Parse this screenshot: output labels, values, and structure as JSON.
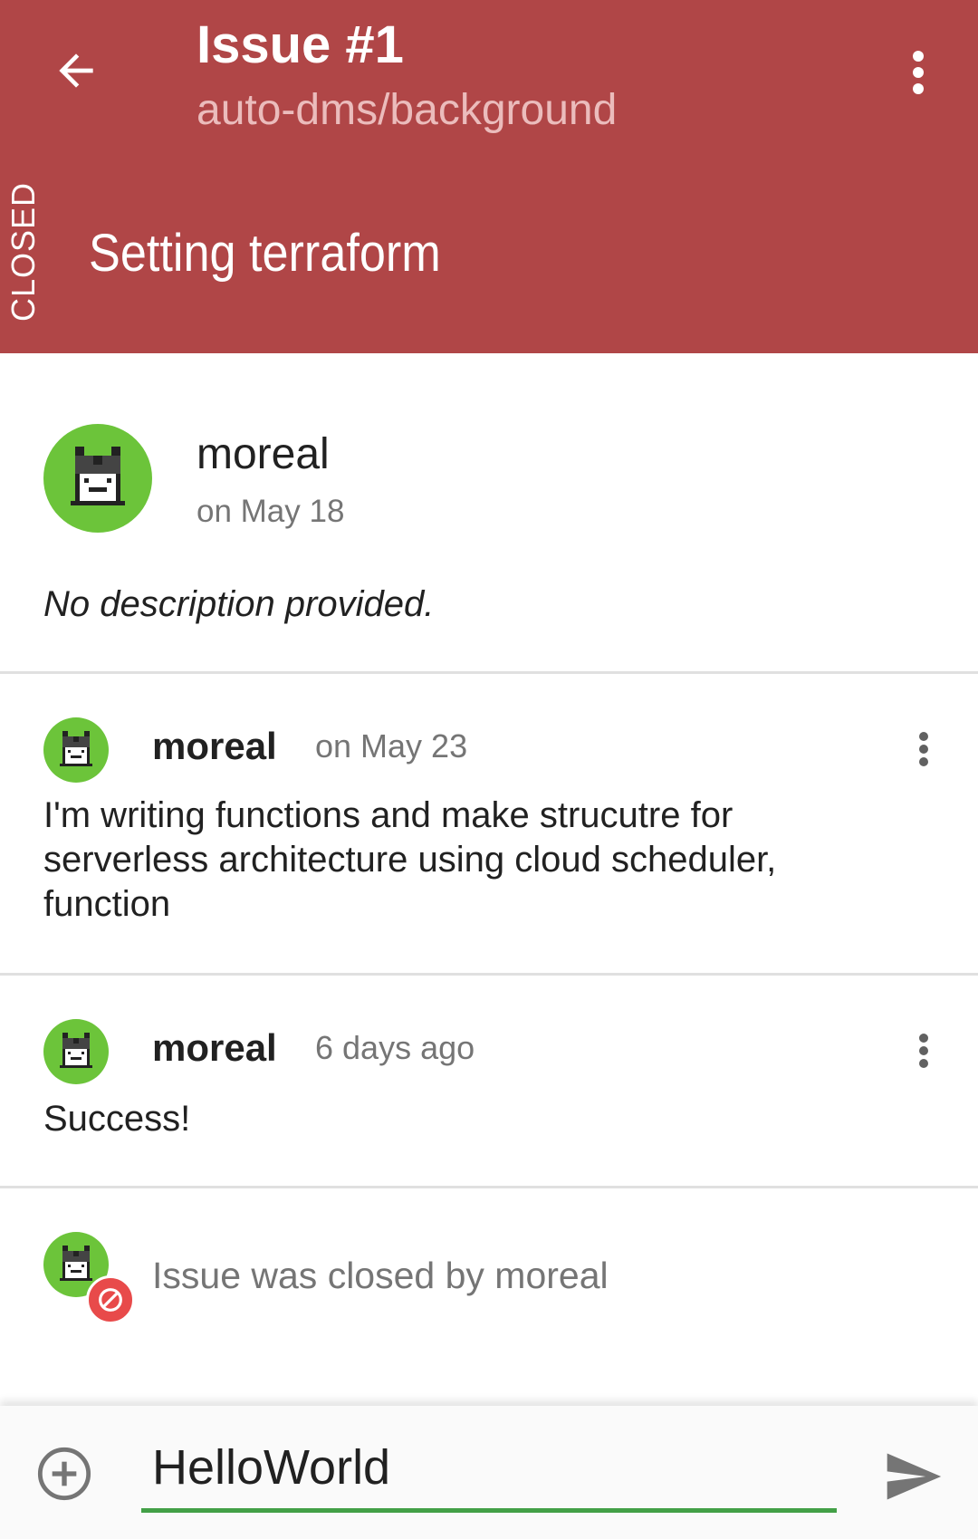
{
  "header": {
    "issue_number": "Issue #1",
    "repository": "auto-dms/background",
    "status": "CLOSED",
    "title": "Setting terraform",
    "background_color": "#b04647",
    "back_icon": "arrow-back-icon",
    "menu_icon": "more-vertical-icon"
  },
  "issue": {
    "author": "moreal",
    "date": "on May 18",
    "body": "No description provided."
  },
  "comments": [
    {
      "author": "moreal",
      "time": "on May 23",
      "lines": [
        "I'm writing functions and make strucutre for",
        "serverless architecture using cloud scheduler,",
        "function"
      ]
    },
    {
      "author": "moreal",
      "time": "6 days ago",
      "lines": [
        "Success!"
      ]
    }
  ],
  "events": {
    "closed_text": "Issue was closed by moreal",
    "closed_icon": "blocked-icon",
    "closed_color": "#e84a4a"
  },
  "composer": {
    "value": "HelloWorld",
    "attach_icon": "add-circle-icon",
    "send_icon": "send-icon",
    "accent_color": "#43a047"
  },
  "avatar_color": "#6cc43a"
}
